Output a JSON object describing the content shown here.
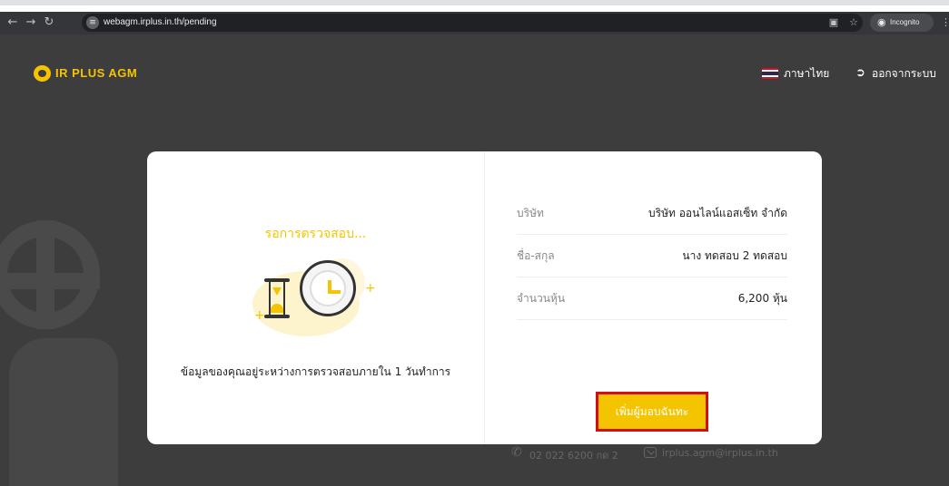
{
  "browser": {
    "url": "webagm.irplus.in.th/pending",
    "incognito_label": "Incognito",
    "icons": [
      "back-icon",
      "forward-icon",
      "reload-icon",
      "site-info-icon",
      "translate-icon",
      "star-icon",
      "incognito-icon",
      "more-icon"
    ]
  },
  "header": {
    "logo_text": "IR PLUS AGM",
    "language_label": "ภาษาไทย",
    "logout_label": "ออกจากระบบ"
  },
  "status": {
    "title": "รอการตรวจสอบ...",
    "message": "ข้อมูลของคุณอยู่ระหว่างการตรวจสอบภายใน 1 วันทำการ"
  },
  "info": [
    {
      "label": "บริษัท",
      "value": "บริษัท ออนไลน์แอสเซ็ท จำกัด"
    },
    {
      "label": "ชื่อ-สกุล",
      "value": "นาง ทดสอบ 2 ทดสอบ"
    },
    {
      "label": "จำนวนหุ้น",
      "value": "6,200 หุ้น"
    }
  ],
  "actions": {
    "add_proxy_label": "เพิ่มผู้มอบฉันทะ"
  },
  "contact": {
    "phone": "02 022 6200 กด 2",
    "email": "irplus.agm@irplus.in.th"
  },
  "colors": {
    "accent": "#f5c400",
    "page_bg": "#3d3d3d",
    "highlight_border": "#d10f0f"
  }
}
